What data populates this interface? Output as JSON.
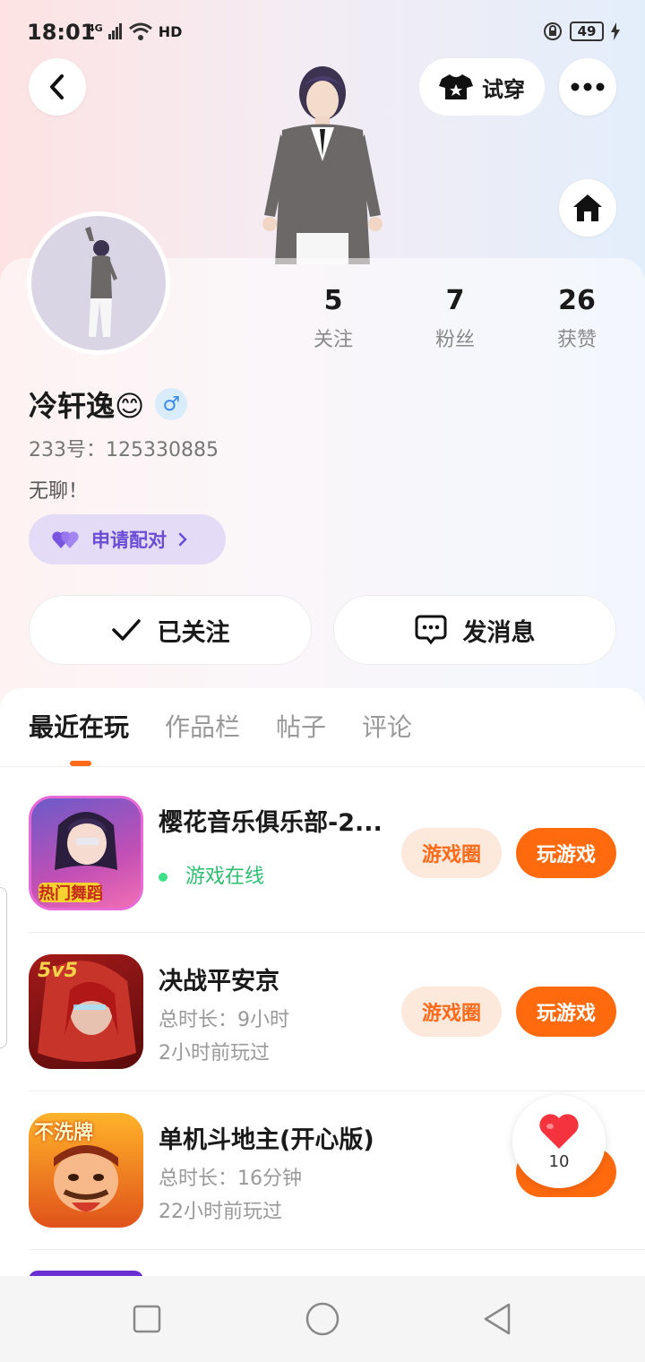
{
  "status_bar": {
    "time": "18:01",
    "network": "4G",
    "hd": "HD",
    "battery": "49"
  },
  "header": {
    "try_on_label": "试穿"
  },
  "profile": {
    "stats": [
      {
        "num": "5",
        "label": "关注"
      },
      {
        "num": "7",
        "label": "粉丝"
      },
      {
        "num": "26",
        "label": "获赞"
      }
    ],
    "nickname": "冷轩逸😊",
    "gender_symbol": "♂",
    "uid": "233号：125330885",
    "bio": "无聊！",
    "match_label": "申请配对",
    "follow_label": "已关注",
    "message_label": "发消息"
  },
  "tabs": [
    "最近在玩",
    "作品栏",
    "帖子",
    "评论"
  ],
  "games": [
    {
      "title": "樱花音乐俱乐部-2...",
      "status": "游戏在线",
      "circle": "游戏圈",
      "play": "玩游戏",
      "icon_text": "热门舞蹈"
    },
    {
      "title": "决战平安京",
      "duration": "总时长：9小时",
      "last": "2小时前玩过",
      "circle": "游戏圈",
      "play": "玩游戏",
      "icon_text": "5v5"
    },
    {
      "title": "单机斗地主(开心版)",
      "duration": "总时长：16分钟",
      "last": "22小时前玩过",
      "icon_text": "不洗牌"
    }
  ],
  "like_float": {
    "count": "10"
  },
  "colors": {
    "accent": "#ff6a0f",
    "accent_light": "#fde8dc",
    "purple": "#6a4cd5",
    "online": "#2fbf71"
  }
}
